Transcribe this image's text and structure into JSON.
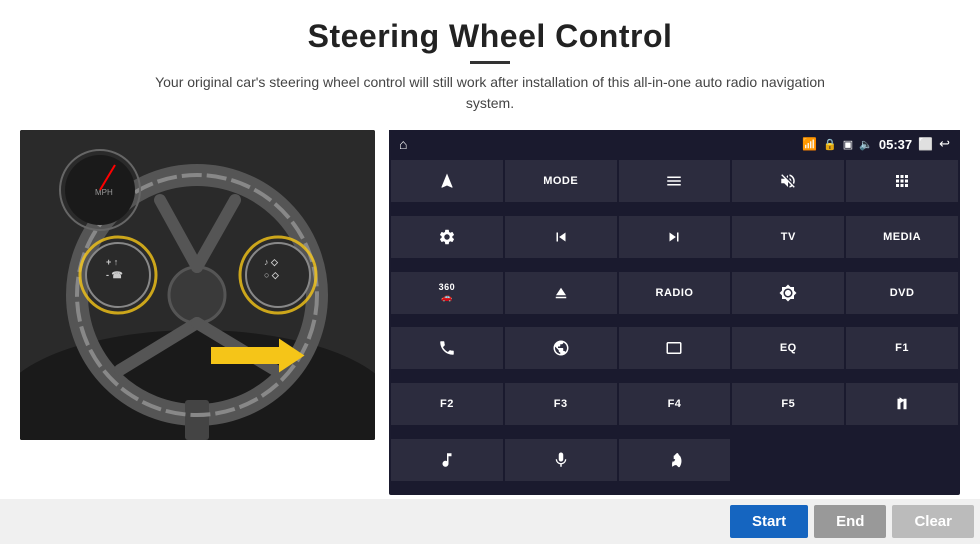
{
  "header": {
    "title": "Steering Wheel Control",
    "description": "Your original car's steering wheel control will still work after installation of this all-in-one auto radio navigation system."
  },
  "status_bar": {
    "time": "05:37",
    "home_icon": "⌂",
    "wifi_icon": "wifi",
    "lock_icon": "🔒",
    "sim_icon": "📶",
    "bt_icon": "bt",
    "screen_icon": "⬜",
    "back_icon": "↩"
  },
  "buttons": [
    {
      "icon": "navigate",
      "label": "",
      "row": 1,
      "col": 1
    },
    {
      "icon": "text",
      "label": "MODE",
      "row": 1,
      "col": 2
    },
    {
      "icon": "list",
      "label": "",
      "row": 1,
      "col": 3
    },
    {
      "icon": "mute",
      "label": "",
      "row": 1,
      "col": 4
    },
    {
      "icon": "apps",
      "label": "",
      "row": 1,
      "col": 5
    },
    {
      "icon": "settings",
      "label": "",
      "row": 2,
      "col": 1
    },
    {
      "icon": "prev",
      "label": "",
      "row": 2,
      "col": 2
    },
    {
      "icon": "next",
      "label": "",
      "row": 2,
      "col": 3
    },
    {
      "icon": "text",
      "label": "TV",
      "row": 2,
      "col": 4
    },
    {
      "icon": "text",
      "label": "MEDIA",
      "row": 2,
      "col": 5
    },
    {
      "icon": "360cam",
      "label": "",
      "row": 3,
      "col": 1
    },
    {
      "icon": "eject",
      "label": "",
      "row": 3,
      "col": 2
    },
    {
      "icon": "text",
      "label": "RADIO",
      "row": 3,
      "col": 3
    },
    {
      "icon": "brightness",
      "label": "",
      "row": 3,
      "col": 4
    },
    {
      "icon": "text",
      "label": "DVD",
      "row": 3,
      "col": 5
    },
    {
      "icon": "phone",
      "label": "",
      "row": 4,
      "col": 1
    },
    {
      "icon": "browse",
      "label": "",
      "row": 4,
      "col": 2
    },
    {
      "icon": "screen",
      "label": "",
      "row": 4,
      "col": 3
    },
    {
      "icon": "text",
      "label": "EQ",
      "row": 4,
      "col": 4
    },
    {
      "icon": "text",
      "label": "F1",
      "row": 4,
      "col": 5
    },
    {
      "icon": "text",
      "label": "F2",
      "row": 5,
      "col": 1
    },
    {
      "icon": "text",
      "label": "F3",
      "row": 5,
      "col": 2
    },
    {
      "icon": "text",
      "label": "F4",
      "row": 5,
      "col": 3
    },
    {
      "icon": "text",
      "label": "F5",
      "row": 5,
      "col": 4
    },
    {
      "icon": "playpause",
      "label": "",
      "row": 5,
      "col": 5
    },
    {
      "icon": "music",
      "label": "",
      "row": 6,
      "col": 1
    },
    {
      "icon": "mic",
      "label": "",
      "row": 6,
      "col": 2
    },
    {
      "icon": "hangup",
      "label": "",
      "row": 6,
      "col": 3
    }
  ],
  "bottom_buttons": {
    "start": "Start",
    "end": "End",
    "clear": "Clear"
  }
}
